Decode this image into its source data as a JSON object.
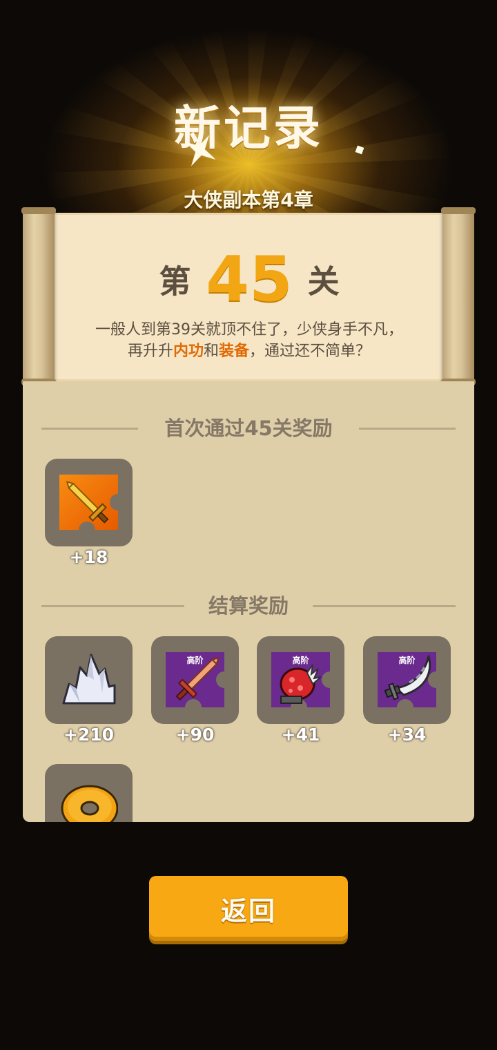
{
  "header": {
    "title": "新记录",
    "subtitle": "大侠副本第4章"
  },
  "level": {
    "prefix": "第",
    "number": "45",
    "suffix": "关",
    "desc_line1": "一般人到第39关就顶不住了，少侠身手不凡，",
    "desc_line2_a": "再升升",
    "desc_line2_hl1": "内功",
    "desc_line2_b": "和",
    "desc_line2_hl2": "装备",
    "desc_line2_c": "，通过还不简单？"
  },
  "first_clear": {
    "header": "首次通过45关奖励",
    "items": [
      {
        "icon": "golden-sword-puzzle-icon",
        "count": "+18"
      }
    ]
  },
  "settlement": {
    "header": "结算奖励",
    "items": [
      {
        "icon": "crystal-icon",
        "count": "+210"
      },
      {
        "icon": "sword-puzzle-icon",
        "tier": "高阶",
        "count": "+90"
      },
      {
        "icon": "gauntlet-puzzle-icon",
        "tier": "高阶",
        "count": "+41"
      },
      {
        "icon": "scimitar-puzzle-icon",
        "tier": "高阶",
        "count": "+34"
      },
      {
        "icon": "gold-coin-icon",
        "count": ""
      }
    ]
  },
  "buttons": {
    "back_label": "返回"
  },
  "colors": {
    "accent": "#f7a812",
    "highlight": "#e06a06",
    "panel": "#dfcfa9",
    "scroll": "#f6e6c6",
    "purple_tile": "#6a2a8e"
  }
}
